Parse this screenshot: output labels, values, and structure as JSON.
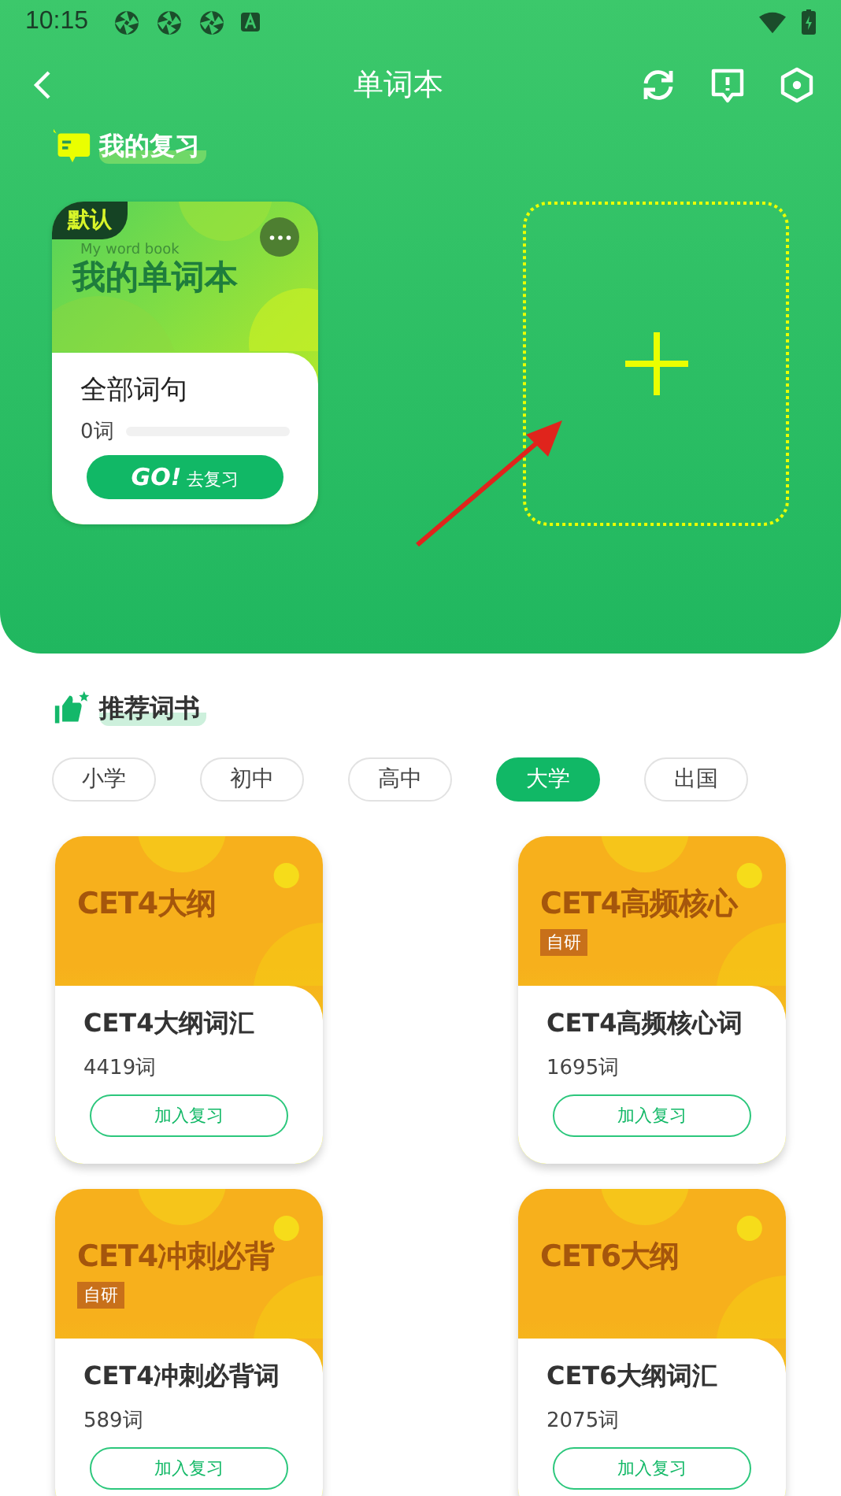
{
  "status_bar": {
    "time": "10:15"
  },
  "header": {
    "title": "单词本"
  },
  "my_review": {
    "title": "我的复习",
    "book": {
      "badge": "默认",
      "subtitle": "My word book",
      "cover_title": "我的单词本",
      "name": "全部词句",
      "count": "0词",
      "level": 0,
      "go": "GO!",
      "button": "去复习"
    }
  },
  "recommended": {
    "title": "推荐词书",
    "categories": [
      {
        "label": "小学",
        "selected": false
      },
      {
        "label": "初中",
        "selected": false
      },
      {
        "label": "高中",
        "selected": false
      },
      {
        "label": "大学",
        "selected": true
      },
      {
        "label": "出国",
        "selected": false
      }
    ],
    "books": [
      {
        "cover_title": "CET4大纲",
        "name": "CET4大纲词汇",
        "count": "4419词",
        "button": "加入复习"
      },
      {
        "cover_title": "CET4高频核心",
        "tag": "自研",
        "name": "CET4高频核心词",
        "count": "1695词",
        "button": "加入复习"
      },
      {
        "cover_title": "CET4冲刺必背",
        "tag": "自研",
        "name": "CET4冲刺必背词",
        "count": "589词",
        "button": "加入复习"
      },
      {
        "cover_title": "CET6大纲",
        "name": "CET6大纲词汇",
        "count": "2075词",
        "button": "加入复习"
      }
    ]
  }
}
